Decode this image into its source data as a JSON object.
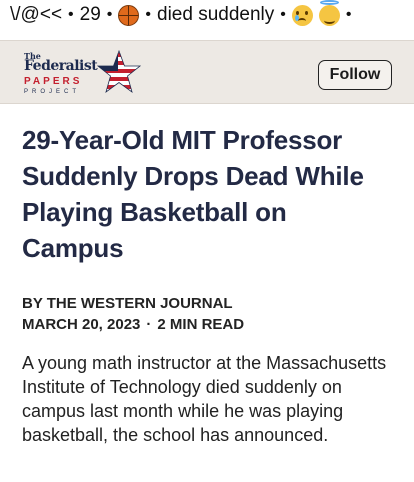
{
  "ticker": {
    "handle": "\\/@<<",
    "sep1": "•",
    "count": "29",
    "sep2": "•",
    "basketball_icon": "basketball-icon",
    "sep3": "•",
    "phrase": "died suddenly",
    "sep4": "•",
    "sad_icon": "sad-tear-face-icon",
    "halo_icon": "smiling-halo-face-icon",
    "sep5": "•"
  },
  "publisher": {
    "logo_the": "The",
    "logo_name": "Federalist",
    "logo_papers": "PAPERS",
    "logo_project": "PROJECT",
    "follow_label": "Follow"
  },
  "article": {
    "headline": "29-Year-Old MIT Professor Suddenly Drops Dead While Playing Basketball on Campus",
    "author": "BY THE WESTERN JOURNAL",
    "date": "MARCH 20, 2023",
    "dot": "·",
    "read_time": "2 MIN READ",
    "body": "A young math instructor at the Massachusetts Institute of Technology died suddenly on campus last month while he was playing basketball, the school has announced."
  },
  "colors": {
    "headline": "#232a45",
    "publisher_bar": "#ede9e4",
    "logo_blue": "#1d2b4f",
    "logo_red": "#c4202f"
  }
}
